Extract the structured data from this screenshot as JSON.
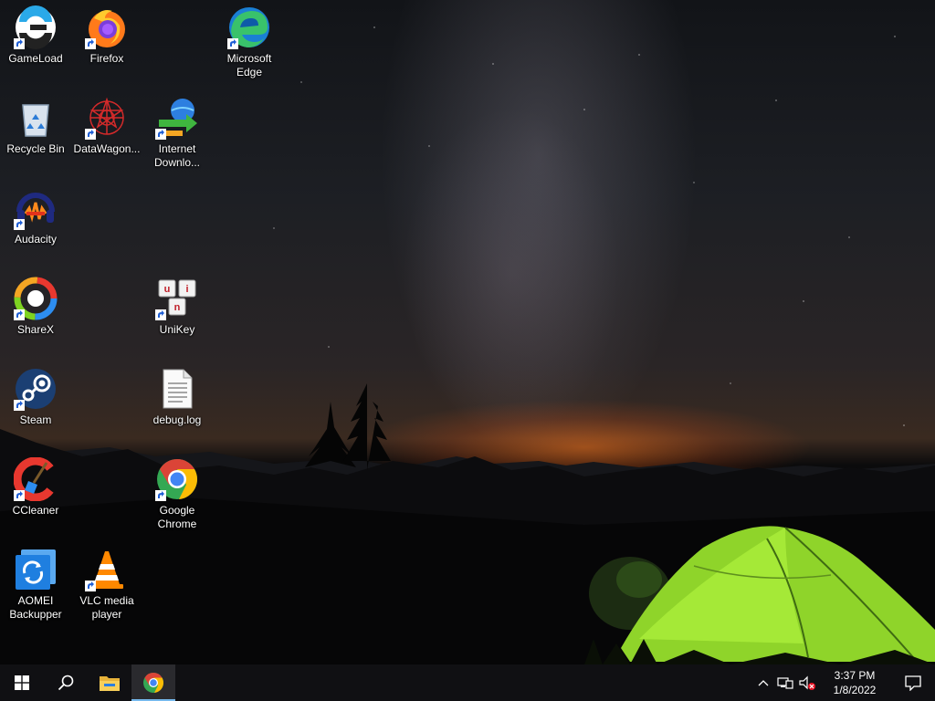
{
  "desktop": {
    "icons": {
      "gameload": {
        "label": "GameLoad"
      },
      "firefox": {
        "label": "Firefox"
      },
      "edge": {
        "label": "Microsoft Edge"
      },
      "recycle_bin": {
        "label": "Recycle Bin"
      },
      "datawagon": {
        "label": "DataWagon..."
      },
      "internet_download": {
        "label": "Internet Downlo..."
      },
      "audacity": {
        "label": "Audacity"
      },
      "sharex": {
        "label": "ShareX"
      },
      "unikey": {
        "label": "UniKey"
      },
      "steam": {
        "label": "Steam"
      },
      "debug_log": {
        "label": "debug.log"
      },
      "ccleaner": {
        "label": "CCleaner"
      },
      "chrome": {
        "label": "Google Chrome"
      },
      "aomei": {
        "label": "AOMEI Backupper"
      },
      "vlc": {
        "label": "VLC media player"
      }
    }
  },
  "taskbar": {
    "buttons": [
      "windows-start",
      "search",
      "file-explorer",
      "google-chrome"
    ],
    "active_button": "google-chrome",
    "tray": {
      "icons": [
        "show-hidden-icons",
        "network",
        "volume-muted"
      ]
    },
    "clock": {
      "time": "3:37 PM",
      "date": "1/8/2022"
    }
  },
  "colors": {
    "taskbar_bg": "#101013",
    "active_indicator": "#76b9ed",
    "tent_green": "#9be030",
    "horizon_glow": "#ff7a1e"
  }
}
